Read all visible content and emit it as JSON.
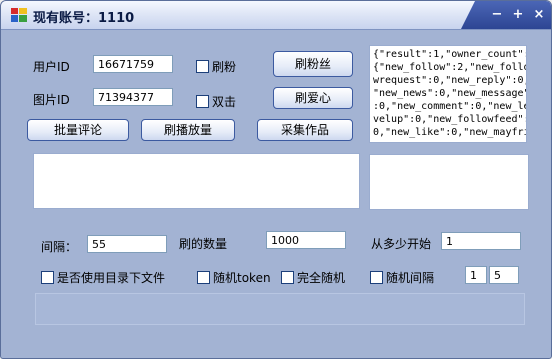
{
  "window": {
    "title": "现有账号：1110"
  },
  "titlebar": {
    "minimize": "−",
    "maximize": "+",
    "close": "×"
  },
  "form": {
    "user_id_label": "用户ID",
    "user_id_value": "16671759",
    "image_id_label": "图片ID",
    "image_id_value": "71394377",
    "chk_fans": "刷粉",
    "chk_double": "双击",
    "btn_fans": "刷粉丝",
    "btn_love": "刷爱心",
    "btn_batch_comment": "批量评论",
    "btn_play_count": "刷播放量",
    "btn_collect": "采集作品",
    "interval_label": "间隔：",
    "interval_value": "55",
    "amount_label": "刷的数量",
    "amount_value": "1000",
    "start_label": "从多少开始",
    "start_value": "1",
    "chk_use_dir": "是否使用目录下文件",
    "chk_random_token": "随机token",
    "chk_full_random": "完全随机",
    "chk_random_interval": "随机间隔",
    "rand_min": "1",
    "rand_max": "5"
  },
  "response": {
    "lines": [
      "{\"result\":1,\"owner_count\":",
      "{\"new_follow\":2,\"new_follo",
      "wrequest\":0,\"new_reply\":0,",
      "\"new_news\":0,\"new_message\"",
      ":0,\"new_comment\":0,\"new_le",
      "velup\":0,\"new_followfeed\":",
      "0,\"new_like\":0,\"new_mayfri"
    ]
  }
}
